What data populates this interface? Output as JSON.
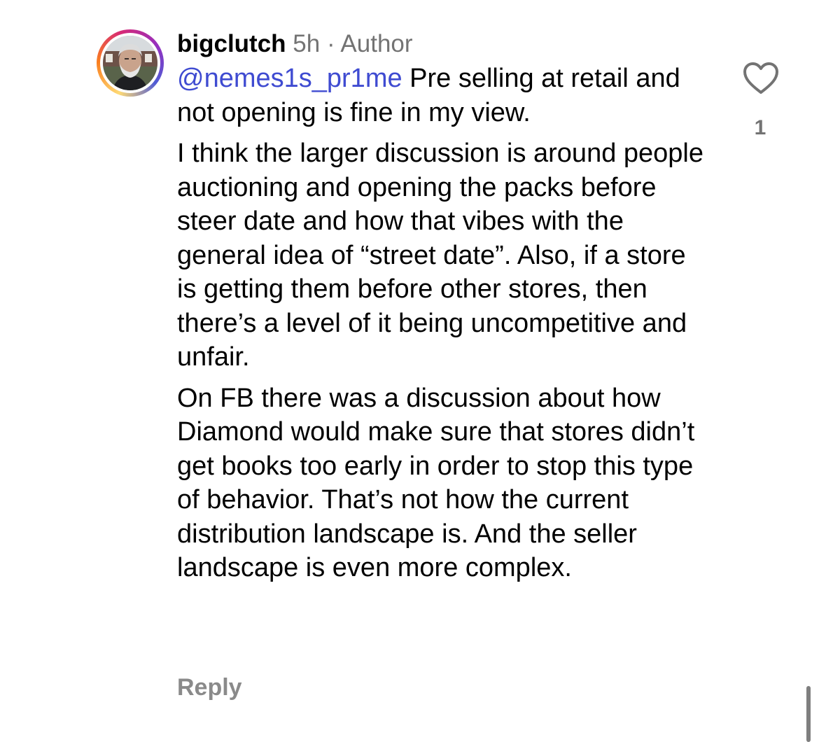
{
  "comment": {
    "username": "bigclutch",
    "time": "5h",
    "separator": "·",
    "author_badge": "Author",
    "mention": "@nemes1s_pr1me",
    "paragraph1_rest": " Pre selling at retail and not opening is fine in my view.",
    "paragraph2": "I think the larger discussion is around people auctioning and opening the packs before steer date and how that vibes with the general idea of “street date”. Also, if a store is getting them before other stores, then there’s a level of it being uncompetitive and unfair.",
    "paragraph3": "On FB there was a discussion about how Diamond would make sure that stores didn’t get books too early in order to stop this type of behavior. That’s not how the current distribution landscape is. And the seller landscape is even more complex.",
    "reply_label": "Reply",
    "like_count": "1",
    "like_icon": "heart-outline-icon",
    "avatar_ring_colors": [
      "#feda75",
      "#fa7e1e",
      "#d62976",
      "#962fbf",
      "#4f5bd5"
    ]
  },
  "colors": {
    "mention": "#3f4bd1",
    "secondary_text": "#737373",
    "reply_text": "#8a8a8a",
    "scrollbar": "#7f7f7f"
  }
}
